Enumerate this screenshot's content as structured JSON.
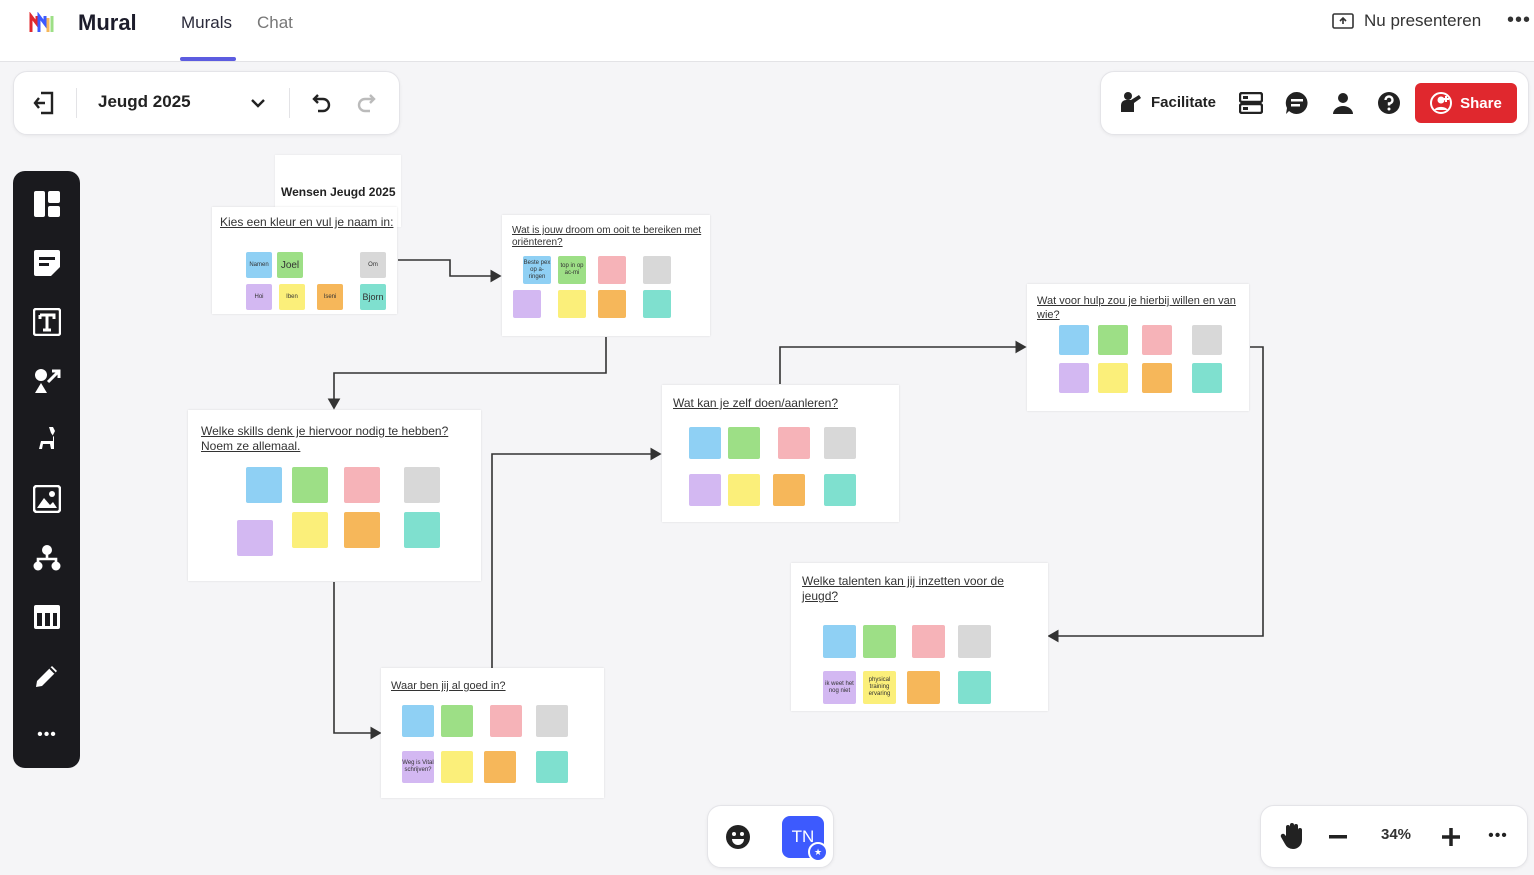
{
  "app": {
    "name": "Mural",
    "tabs": [
      {
        "label": "Murals"
      },
      {
        "label": "Chat"
      }
    ],
    "present_label": "Nu presenteren"
  },
  "toolbar": {
    "mural_title": "Jeugd 2025",
    "facilitate_label": "Facilitate",
    "share_label": "Share"
  },
  "canvas": {
    "board_label": "Wensen Jeugd 2025",
    "frames": [
      {
        "title": "Kies een kleur en vul je naam in:",
        "notes": [
          "Namen",
          "Joel",
          "",
          "Om",
          "Hoi",
          "Iben",
          "Iseni",
          "Bjorn"
        ]
      },
      {
        "title": "Wat is jouw droom om ooit te bereiken met oriënteren?",
        "notes": [
          "Beste pex op a-ringen",
          "top in op ac-mi",
          "",
          "",
          "",
          "",
          "",
          ""
        ]
      },
      {
        "title": "Wat voor hulp zou je hierbij willen en van wie?",
        "notes": [
          "",
          "",
          "",
          "",
          "",
          "",
          "",
          ""
        ]
      },
      {
        "title": "Wat kan je zelf doen/aanleren?",
        "notes": [
          "",
          "",
          "",
          "",
          "",
          "",
          "",
          ""
        ]
      },
      {
        "title": "Welke skills denk je hiervoor nodig te hebben? Noem ze allemaal.",
        "notes": [
          "",
          "",
          "",
          "",
          "",
          "",
          "",
          ""
        ]
      },
      {
        "title": "Welke talenten kan jij inzetten voor de jeugd?",
        "notes": [
          "",
          "",
          "",
          "",
          "ik weet het nog niet",
          "physical training ervaring",
          "",
          ""
        ]
      },
      {
        "title": "Waar ben jij al goed in?",
        "notes": [
          "",
          "",
          "",
          "",
          "Weg is Vital schrijven?",
          "",
          "",
          ""
        ]
      }
    ]
  },
  "user": {
    "initials": "TN"
  },
  "zoom": {
    "level": "34%"
  },
  "colors": {
    "share": "#e0282e",
    "accent": "#5c5ce0",
    "toolbar_bg": "#1a1a1e",
    "avatar": "#3d5afe"
  }
}
